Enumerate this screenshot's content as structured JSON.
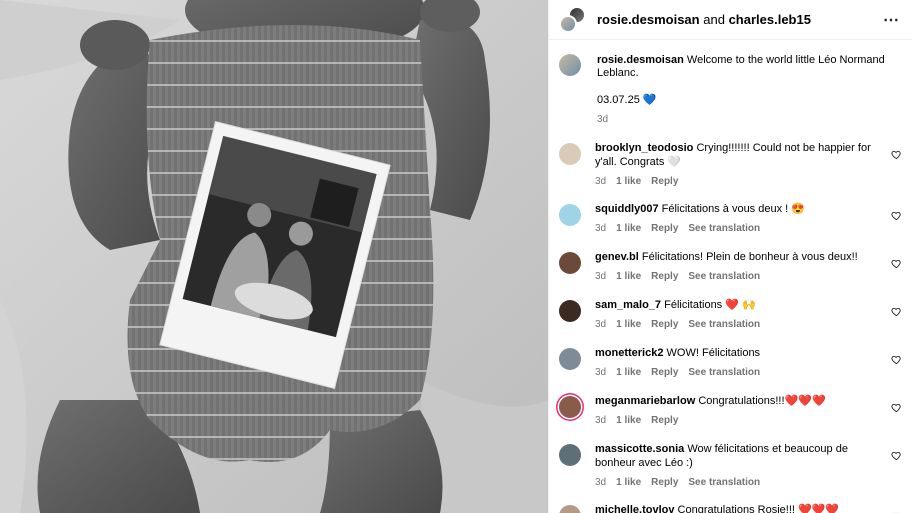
{
  "header": {
    "user1": "rosie.desmoisan",
    "joiner": "and",
    "user2": "charles.leb15",
    "more_icon": "more-horizontal-icon"
  },
  "caption": {
    "username": "rosie.desmoisan",
    "text": "Welcome to the world little Léo Normand Leblanc.",
    "date": "03.07.25",
    "emoji": "💙",
    "age": "3d"
  },
  "comments": [
    {
      "username": "brooklyn_teodosio",
      "text": "Crying!!!!!!! Could not be happier for y'all. Congrats 🤍",
      "age": "3d",
      "likes": "1 like",
      "reply": "Reply",
      "translation": "",
      "avatar_color": "#d9cbb8"
    },
    {
      "username": "squiddly007",
      "text": "Félicitations à vous deux ! 😍",
      "age": "3d",
      "likes": "1 like",
      "reply": "Reply",
      "translation": "See translation",
      "avatar_color": "#9fd3e6"
    },
    {
      "username": "genev.bl",
      "text": "Félicitations! Plein de bonheur à vous deux!!",
      "age": "3d",
      "likes": "1 like",
      "reply": "Reply",
      "translation": "See translation",
      "avatar_color": "#6b4a3a"
    },
    {
      "username": "sam_malo_7",
      "text": "Félicitations ❤️ 🙌",
      "age": "3d",
      "likes": "1 like",
      "reply": "Reply",
      "translation": "See translation",
      "avatar_color": "#3b2a22"
    },
    {
      "username": "monetterick2",
      "text": "WOW! Félicitations",
      "age": "3d",
      "likes": "1 like",
      "reply": "Reply",
      "translation": "See translation",
      "avatar_color": "#7d8c96"
    },
    {
      "username": "meganmariebarlow",
      "text": "Congratulations!!!❤️❤️❤️",
      "age": "3d",
      "likes": "1 like",
      "reply": "Reply",
      "translation": "",
      "avatar_color": "#8a5a4a"
    },
    {
      "username": "massicotte.sonia",
      "text": "Wow félicitations et beaucoup de bonheur avec Léo :)",
      "age": "3d",
      "likes": "1 like",
      "reply": "Reply",
      "translation": "See translation",
      "avatar_color": "#5f6f78"
    },
    {
      "username": "michelle.tovlov",
      "text": "Congratulations Rosie!!! ❤️❤️❤️",
      "age": "",
      "likes": "",
      "reply": "",
      "translation": "",
      "avatar_color": "#b49a88"
    }
  ],
  "colors": {
    "meta_gray": "#737373",
    "border": "#efefef",
    "story_ring_start": "#f9ce34",
    "story_ring_end": "#ee2a7b"
  }
}
